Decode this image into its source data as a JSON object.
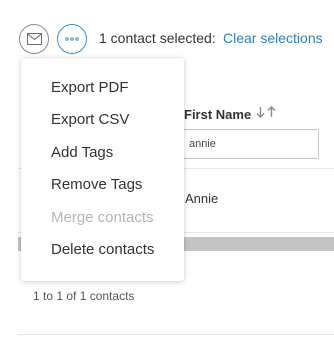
{
  "toolbar": {
    "mail_icon": "envelope-icon",
    "more_icon": "ellipsis-icon",
    "selection_text": "1 contact selected:",
    "clear_label": "Clear selections",
    "accent_color": "#2b7fc0"
  },
  "menu": {
    "items": [
      {
        "label": "Export PDF",
        "disabled": false
      },
      {
        "label": "Export CSV",
        "disabled": false
      },
      {
        "label": "Add Tags",
        "disabled": false
      },
      {
        "label": "Remove Tags",
        "disabled": false
      },
      {
        "label": "Merge contacts",
        "disabled": true
      },
      {
        "label": "Delete contacts",
        "disabled": false
      }
    ]
  },
  "grid": {
    "column_header": "First Name",
    "sort_icons": [
      "arrow-down-icon",
      "arrow-up-icon"
    ],
    "filter_value": "annie",
    "rows": [
      {
        "first_name": "Annie"
      }
    ],
    "paging_text": "1 to 1 of 1 contacts"
  }
}
